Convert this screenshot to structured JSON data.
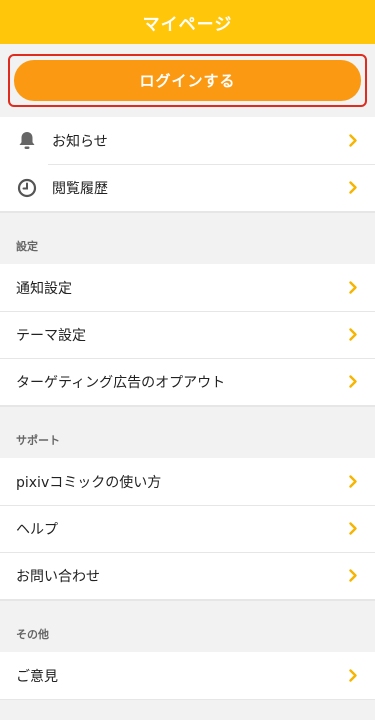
{
  "header": {
    "title": "マイページ"
  },
  "login": {
    "label": "ログインする"
  },
  "top_items": [
    {
      "label": "お知らせ",
      "icon": "bell-icon"
    },
    {
      "label": "閲覧履歴",
      "icon": "clock-icon"
    }
  ],
  "sections": [
    {
      "title": "設定",
      "items": [
        "通知設定",
        "テーマ設定",
        "ターゲティング広告のオプアウト"
      ]
    },
    {
      "title": "サポート",
      "items": [
        "pixivコミックの使い方",
        "ヘルプ",
        "お問い合わせ"
      ]
    },
    {
      "title": "その他",
      "items": [
        "ご意見"
      ]
    }
  ],
  "colors": {
    "brand": "#ffc60a",
    "accent": "#fb9a12",
    "highlight": "#e02b1f",
    "chevron": "#f7b500"
  }
}
